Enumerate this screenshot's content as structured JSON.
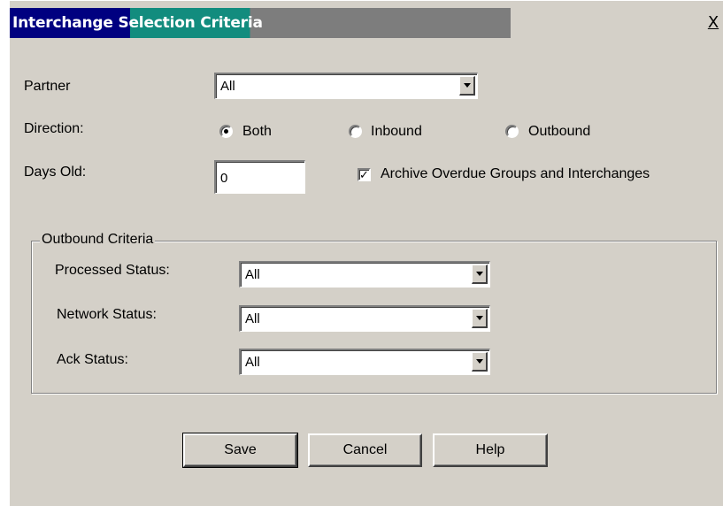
{
  "window": {
    "title": "Interchange Selection Criteria",
    "close_label": "X"
  },
  "form": {
    "partner": {
      "label": "Partner",
      "value": "All"
    },
    "direction": {
      "label": "Direction:",
      "options": [
        "Both",
        "Inbound",
        "Outbound"
      ],
      "selected": "Both"
    },
    "days_old": {
      "label": "Days Old:",
      "value": "0"
    },
    "archive": {
      "label": "Archive Overdue Groups and Interchanges",
      "checked": true
    }
  },
  "outbound_criteria": {
    "legend": "Outbound Criteria",
    "processed_status": {
      "label": "Processed Status:",
      "value": "All"
    },
    "network_status": {
      "label": "Network Status:",
      "value": "All"
    },
    "ack_status": {
      "label": "Ack Status:",
      "value": "All"
    }
  },
  "buttons": {
    "save": "Save",
    "cancel": "Cancel",
    "help": "Help"
  },
  "colors": {
    "title_bar_start": "#000080",
    "title_bar_mid": "#128c7e",
    "title_bar_end": "#7d7d7d",
    "dialog_face": "#d4d0c8"
  },
  "icons": {
    "checkbox": "check-mark",
    "dropdown": "chevron-down"
  }
}
